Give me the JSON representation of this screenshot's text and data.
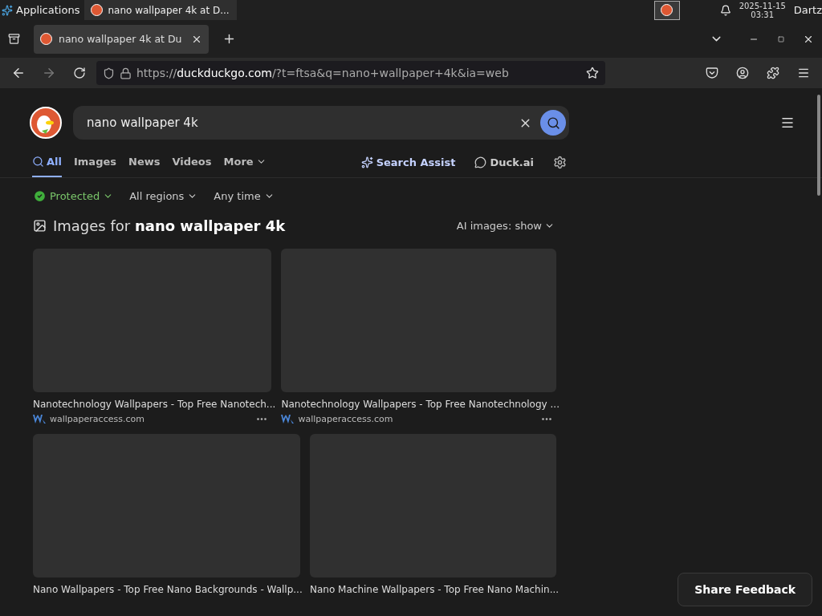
{
  "taskbar": {
    "menu": "Applications",
    "task": "nano wallpaper 4k at D...",
    "date": "2025-11-15",
    "time": "03:31",
    "user": "Dartz"
  },
  "browser": {
    "tab": {
      "title": "nano wallpaper 4k at Du",
      "selected": true
    },
    "url": {
      "scheme": "https://",
      "domain": "duckduckgo.com",
      "rest": "/?t=ftsa&q=nano+wallpaper+4k&ia=web"
    }
  },
  "search": {
    "value": "nano wallpaper 4k"
  },
  "nav_tabs": [
    {
      "label": "All",
      "selected": true
    },
    {
      "label": "Images",
      "selected": false
    },
    {
      "label": "News",
      "selected": false
    },
    {
      "label": "Videos",
      "selected": false
    },
    {
      "label": "More",
      "selected": false
    }
  ],
  "assist": "Search Assist",
  "duck_ai": "Duck.ai",
  "filters": [
    {
      "label": "Protected",
      "kind": "protected"
    },
    {
      "label": "All regions",
      "kind": "dropdown"
    },
    {
      "label": "Any time",
      "kind": "dropdown"
    }
  ],
  "images_heading": "Images for **nano wallpaper 4k**",
  "ai_images": "AI images: show",
  "image_rows": [
    [
      {
        "title": "Nanotechnology Wallpapers - Top Free Nanotech...",
        "source": "wallpaperaccess.com"
      },
      {
        "title": "Nanotechnology Wallpapers - Top Free Nanotechnology ...",
        "source": "wallpaperaccess.com"
      }
    ],
    [
      {
        "title": "Nano Wallpapers - Top Free Nano Backgrounds - Wallp..."
      },
      {
        "title": "Nano Machine Wallpapers - Top Free Nano Machin..."
      }
    ]
  ],
  "feedback": "Share Feedback"
}
